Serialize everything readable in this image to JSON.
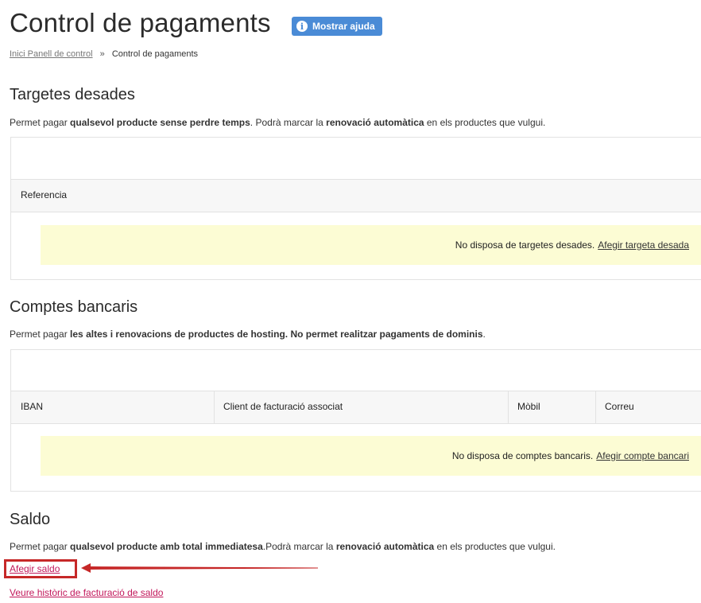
{
  "header": {
    "title": "Control de pagaments",
    "help_button": "Mostrar ajuda",
    "info_icon_glyph": "i"
  },
  "breadcrumb": {
    "link": "Inici Panell de control",
    "separator": "»",
    "current": "Control de pagaments"
  },
  "cards": {
    "title": "Targetes desades",
    "desc_pre": "Permet pagar ",
    "desc_b1": "qualsevol producte sense perdre temps",
    "desc_mid": ". Podrà marcar la ",
    "desc_b2": "renovació automàtica",
    "desc_post": " en els productes que vulgui.",
    "columns": [
      "Referencia"
    ],
    "empty_text": "No disposa de targetes desades.",
    "empty_link": "Afegir targeta desada"
  },
  "bank": {
    "title": "Comptes bancaris",
    "desc_pre": "Permet pagar ",
    "desc_b1": "les altes i renovacions de productes de hosting. No permet realitzar pagaments de dominis",
    "desc_post": ".",
    "columns": [
      "IBAN",
      "Client de facturació associat",
      "Mòbil",
      "Correu"
    ],
    "empty_text": "No disposa de comptes bancaris.",
    "empty_link": "Afegir compte bancari"
  },
  "balance": {
    "title": "Saldo",
    "desc_pre": "Permet pagar ",
    "desc_b1": "qualsevol producte amb total immediatesa",
    "desc_mid": ".Podrà marcar la ",
    "desc_b2": "renovació automàtica",
    "desc_post": " en els productes que vulgui.",
    "add_link": "Afegir saldo",
    "history_link": "Veure històric de facturació de saldo"
  },
  "colors": {
    "accent": "#4a8bd6",
    "link_pink": "#c2185b",
    "highlight_red": "#c62828",
    "notice_bg": "#fcfcd4"
  }
}
